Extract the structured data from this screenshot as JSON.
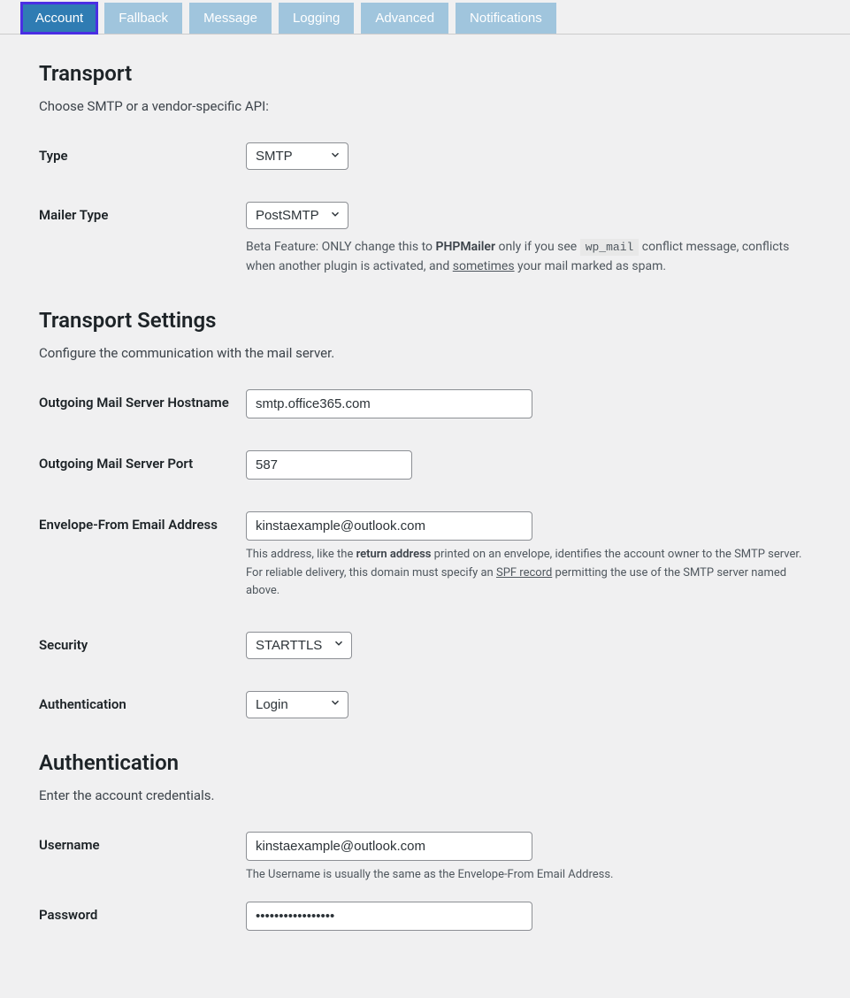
{
  "tabs": [
    {
      "label": "Account",
      "active": true
    },
    {
      "label": "Fallback",
      "active": false
    },
    {
      "label": "Message",
      "active": false
    },
    {
      "label": "Logging",
      "active": false
    },
    {
      "label": "Advanced",
      "active": false
    },
    {
      "label": "Notifications",
      "active": false
    }
  ],
  "transport": {
    "heading": "Transport",
    "desc": "Choose SMTP or a vendor-specific API:",
    "type_label": "Type",
    "type_value": "SMTP",
    "mailer_label": "Mailer Type",
    "mailer_value": "PostSMTP",
    "mailer_help_1": "Beta Feature: ONLY change this to ",
    "mailer_help_bold": "PHPMailer",
    "mailer_help_2": " only if you see ",
    "mailer_help_code": "wp_mail",
    "mailer_help_3": " conflict message, conflicts when another plugin is activated, and ",
    "mailer_help_under": "sometimes",
    "mailer_help_4": " your mail marked as spam."
  },
  "settings": {
    "heading": "Transport Settings",
    "desc": "Configure the communication with the mail server.",
    "host_label": "Outgoing Mail Server Hostname",
    "host_value": "smtp.office365.com",
    "port_label": "Outgoing Mail Server Port",
    "port_value": "587",
    "env_label": "Envelope-From Email Address",
    "env_value": "kinstaexample@outlook.com",
    "env_help_1": "This address, like the ",
    "env_help_bold": "return address",
    "env_help_2": " printed on an envelope, identifies the account owner to the SMTP server. For reliable delivery, this domain must specify an ",
    "env_help_under": "SPF record",
    "env_help_3": " permitting the use of the SMTP server named above.",
    "sec_label": "Security",
    "sec_value": "STARTTLS",
    "auth_label": "Authentication",
    "auth_value": "Login"
  },
  "auth": {
    "heading": "Authentication",
    "desc": "Enter the account credentials.",
    "user_label": "Username",
    "user_value": "kinstaexample@outlook.com",
    "user_help": "The Username is usually the same as the Envelope-From Email Address.",
    "pass_label": "Password",
    "pass_value": "•••••••••••••••••"
  }
}
